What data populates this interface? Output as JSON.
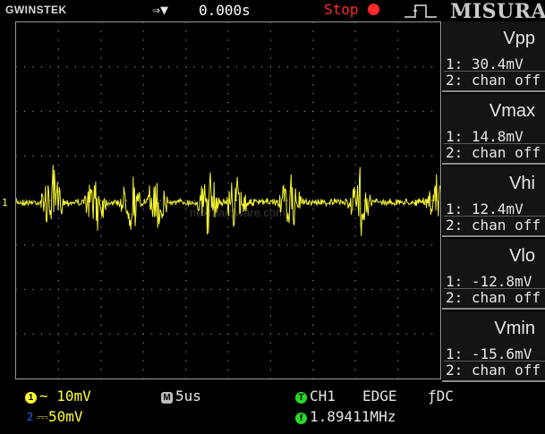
{
  "topbar": {
    "brand": "GWINSTEK",
    "trigger_mode": "⇒▼",
    "trigger_time": "0.000s",
    "run_state": "Stop",
    "title": "MISURA",
    "edge_icon": "rising-edge-icon"
  },
  "screen": {
    "channel_marker": "1",
    "watermark": "nexthardware.com",
    "grid_divisions": {
      "x": 10,
      "y": 8
    },
    "trace_color": "#ffff33"
  },
  "measurements": [
    {
      "name": "Vpp",
      "ch1": "1: 30.4mV",
      "ch2": "2: chan off"
    },
    {
      "name": "Vmax",
      "ch1": "1: 14.8mV",
      "ch2": "2: chan off"
    },
    {
      "name": "Vhi",
      "ch1": "1: 12.4mV",
      "ch2": "2: chan off"
    },
    {
      "name": "Vlo",
      "ch1": "1: -12.8mV",
      "ch2": "2: chan off"
    },
    {
      "name": "Vmin",
      "ch1": "1: -15.6mV",
      "ch2": "2: chan off"
    }
  ],
  "status": {
    "ch1_scale": "~ 10mV",
    "ch2_scale": "⎓50mV",
    "timebase_badge": "M",
    "timebase": "5us",
    "trigger_source": "CH1",
    "trigger_type": "EDGE",
    "trigger_coupling": "ƒDC",
    "frequency_badge": "f",
    "frequency": "1.89411MHz"
  }
}
